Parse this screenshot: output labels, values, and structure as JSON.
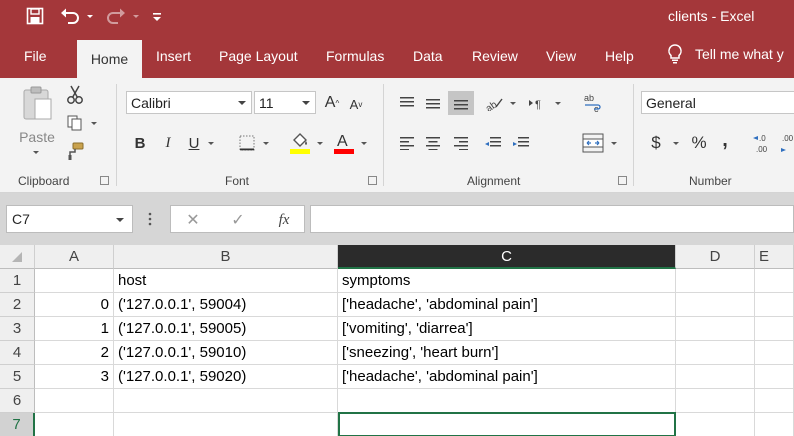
{
  "window": {
    "title": "clients  -  Excel",
    "accent_color": "#a4373a",
    "quick_access": [
      {
        "name": "save-icon",
        "glyph": "💾"
      },
      {
        "name": "undo-icon",
        "glyph": "↶"
      },
      {
        "name": "redo-icon",
        "glyph": "↷"
      },
      {
        "name": "customize-qat-icon",
        "glyph": "≡"
      }
    ]
  },
  "tabs": [
    {
      "label": "File"
    },
    {
      "label": "Home"
    },
    {
      "label": "Insert"
    },
    {
      "label": "Page Layout"
    },
    {
      "label": "Formulas"
    },
    {
      "label": "Data"
    },
    {
      "label": "Review"
    },
    {
      "label": "View"
    },
    {
      "label": "Help"
    }
  ],
  "tell_me": "Tell me what y",
  "ribbon": {
    "clipboard": {
      "label": "Clipboard",
      "paste": "Paste"
    },
    "font": {
      "label": "Font",
      "name": "Calibri",
      "size": "11",
      "bold": "B",
      "italic": "I",
      "underline": "U",
      "grow": "A",
      "shrink": "A",
      "highlight_color": "#ffff00",
      "font_color": "#ff0000"
    },
    "alignment": {
      "label": "Alignment",
      "wrap": "ab→c"
    },
    "number": {
      "label": "Number",
      "format": "General",
      "currency": "$",
      "percent": "%",
      "comma": ",",
      "inc_decimal": "←.0\n.00",
      "dec_decimal": ".00\n→.0"
    }
  },
  "formula_bar": {
    "name_box": "C7",
    "cancel": "✕",
    "enter": "✓",
    "fx": "fx",
    "value": ""
  },
  "sheet": {
    "columns": [
      "A",
      "B",
      "C",
      "D",
      "E"
    ],
    "rows": [
      "1",
      "2",
      "3",
      "4",
      "5",
      "6",
      "7"
    ],
    "cells": [
      [
        "",
        "host",
        "symptoms",
        "",
        ""
      ],
      [
        "0",
        "('127.0.0.1', 59004)",
        "['headache', 'abdominal pain']",
        "",
        ""
      ],
      [
        "1",
        "('127.0.0.1', 59005)",
        "['vomiting', 'diarrea']",
        "",
        ""
      ],
      [
        "2",
        "('127.0.0.1', 59010)",
        "['sneezing', 'heart burn']",
        "",
        ""
      ],
      [
        "3",
        "('127.0.0.1', 59020)",
        "['headache', 'abdominal pain']",
        "",
        ""
      ],
      [
        "",
        "",
        "",
        "",
        ""
      ],
      [
        "",
        "",
        "",
        "",
        ""
      ]
    ],
    "active_cell": "C7",
    "selection_color": "#217346"
  }
}
